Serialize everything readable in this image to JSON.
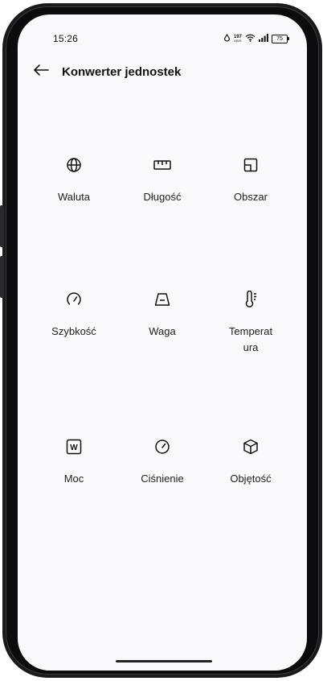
{
  "status_bar": {
    "time": "15:26",
    "net_speed": "197",
    "net_speed_unit": "KB/S",
    "battery": "75"
  },
  "header": {
    "title": "Konwerter jednostek",
    "back_icon": "arrow-left-icon"
  },
  "units": [
    {
      "label": "Waluta",
      "icon": "globe-icon"
    },
    {
      "label": "Długość",
      "icon": "ruler-icon"
    },
    {
      "label": "Obszar",
      "icon": "area-icon"
    },
    {
      "label": "Szybkość",
      "icon": "speedometer-icon"
    },
    {
      "label": "Waga",
      "icon": "weight-icon"
    },
    {
      "label": "Temperat\nura",
      "icon": "thermometer-icon"
    },
    {
      "label": "Moc",
      "icon": "power-icon"
    },
    {
      "label": "Ciśnienie",
      "icon": "gauge-icon"
    },
    {
      "label": "Objętość",
      "icon": "cube-icon"
    }
  ],
  "colors": {
    "screen_bg": "#f9f8fb",
    "text": "#111111",
    "frame": "#1a1a1c"
  }
}
